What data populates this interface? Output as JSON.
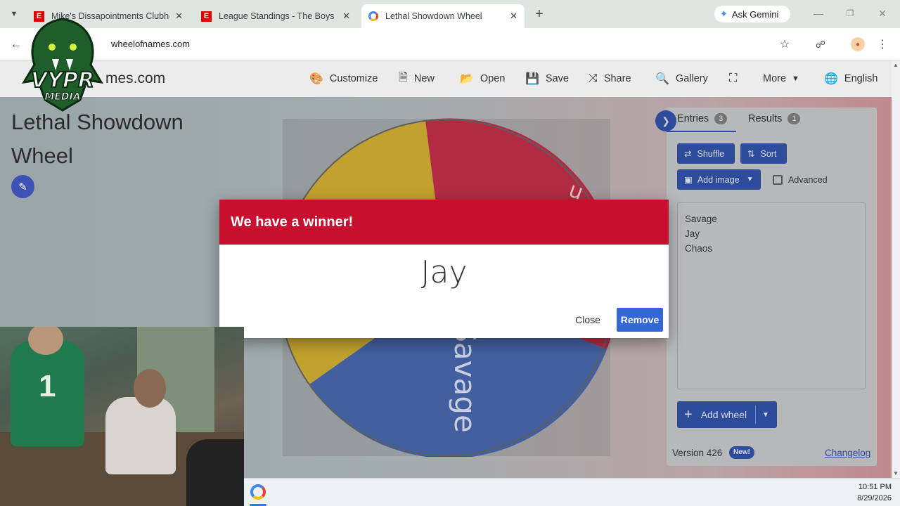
{
  "browser": {
    "tabs": [
      {
        "title": "Mike's Dissapointments Clubho",
        "favicon": "E"
      },
      {
        "title": "League Standings - The Boys - I",
        "favicon": "E"
      },
      {
        "title": "Lethal Showdown Wheel",
        "favicon": "G"
      }
    ],
    "new_tab": "+",
    "gemini_label": "Ask Gemini",
    "url": "wheelofnames.com"
  },
  "app": {
    "site_name": "mes.com",
    "menu": {
      "customize": "Customize",
      "new": "New",
      "open": "Open",
      "save": "Save",
      "share": "Share",
      "gallery": "Gallery",
      "more": "More",
      "language": "English"
    },
    "wheel_title": "Lethal Showdown Wheel"
  },
  "logo": {
    "text": "VYPR",
    "subtext": "MEDIA"
  },
  "wheel": {
    "segments": [
      "Savage",
      "Jay",
      "Chaos"
    ],
    "colors": [
      "#2f56b0",
      "#c8102e",
      "#e0b212"
    ],
    "visible_labels": [
      "Savage",
      "u"
    ]
  },
  "sidepanel": {
    "entries_tab": "Entries",
    "entries_count": "3",
    "results_tab": "Results",
    "results_count": "1",
    "shuffle": "Shuffle",
    "sort": "Sort",
    "add_image": "Add image",
    "advanced": "Advanced",
    "entries": [
      "Savage",
      "Jay",
      "Chaos"
    ],
    "add_wheel": "Add wheel",
    "version": "Version 426",
    "new_badge": "New!",
    "changelog": "Changelog"
  },
  "modal": {
    "heading": "We have a winner!",
    "winner": "Jay",
    "close": "Close",
    "remove": "Remove"
  },
  "taskbar": {
    "time": "10:51 PM",
    "date": "8/29/2026"
  },
  "colors": {
    "accent": "#2e4c9c",
    "modal_header": "#c8102e",
    "remove_button": "#3367d6"
  }
}
